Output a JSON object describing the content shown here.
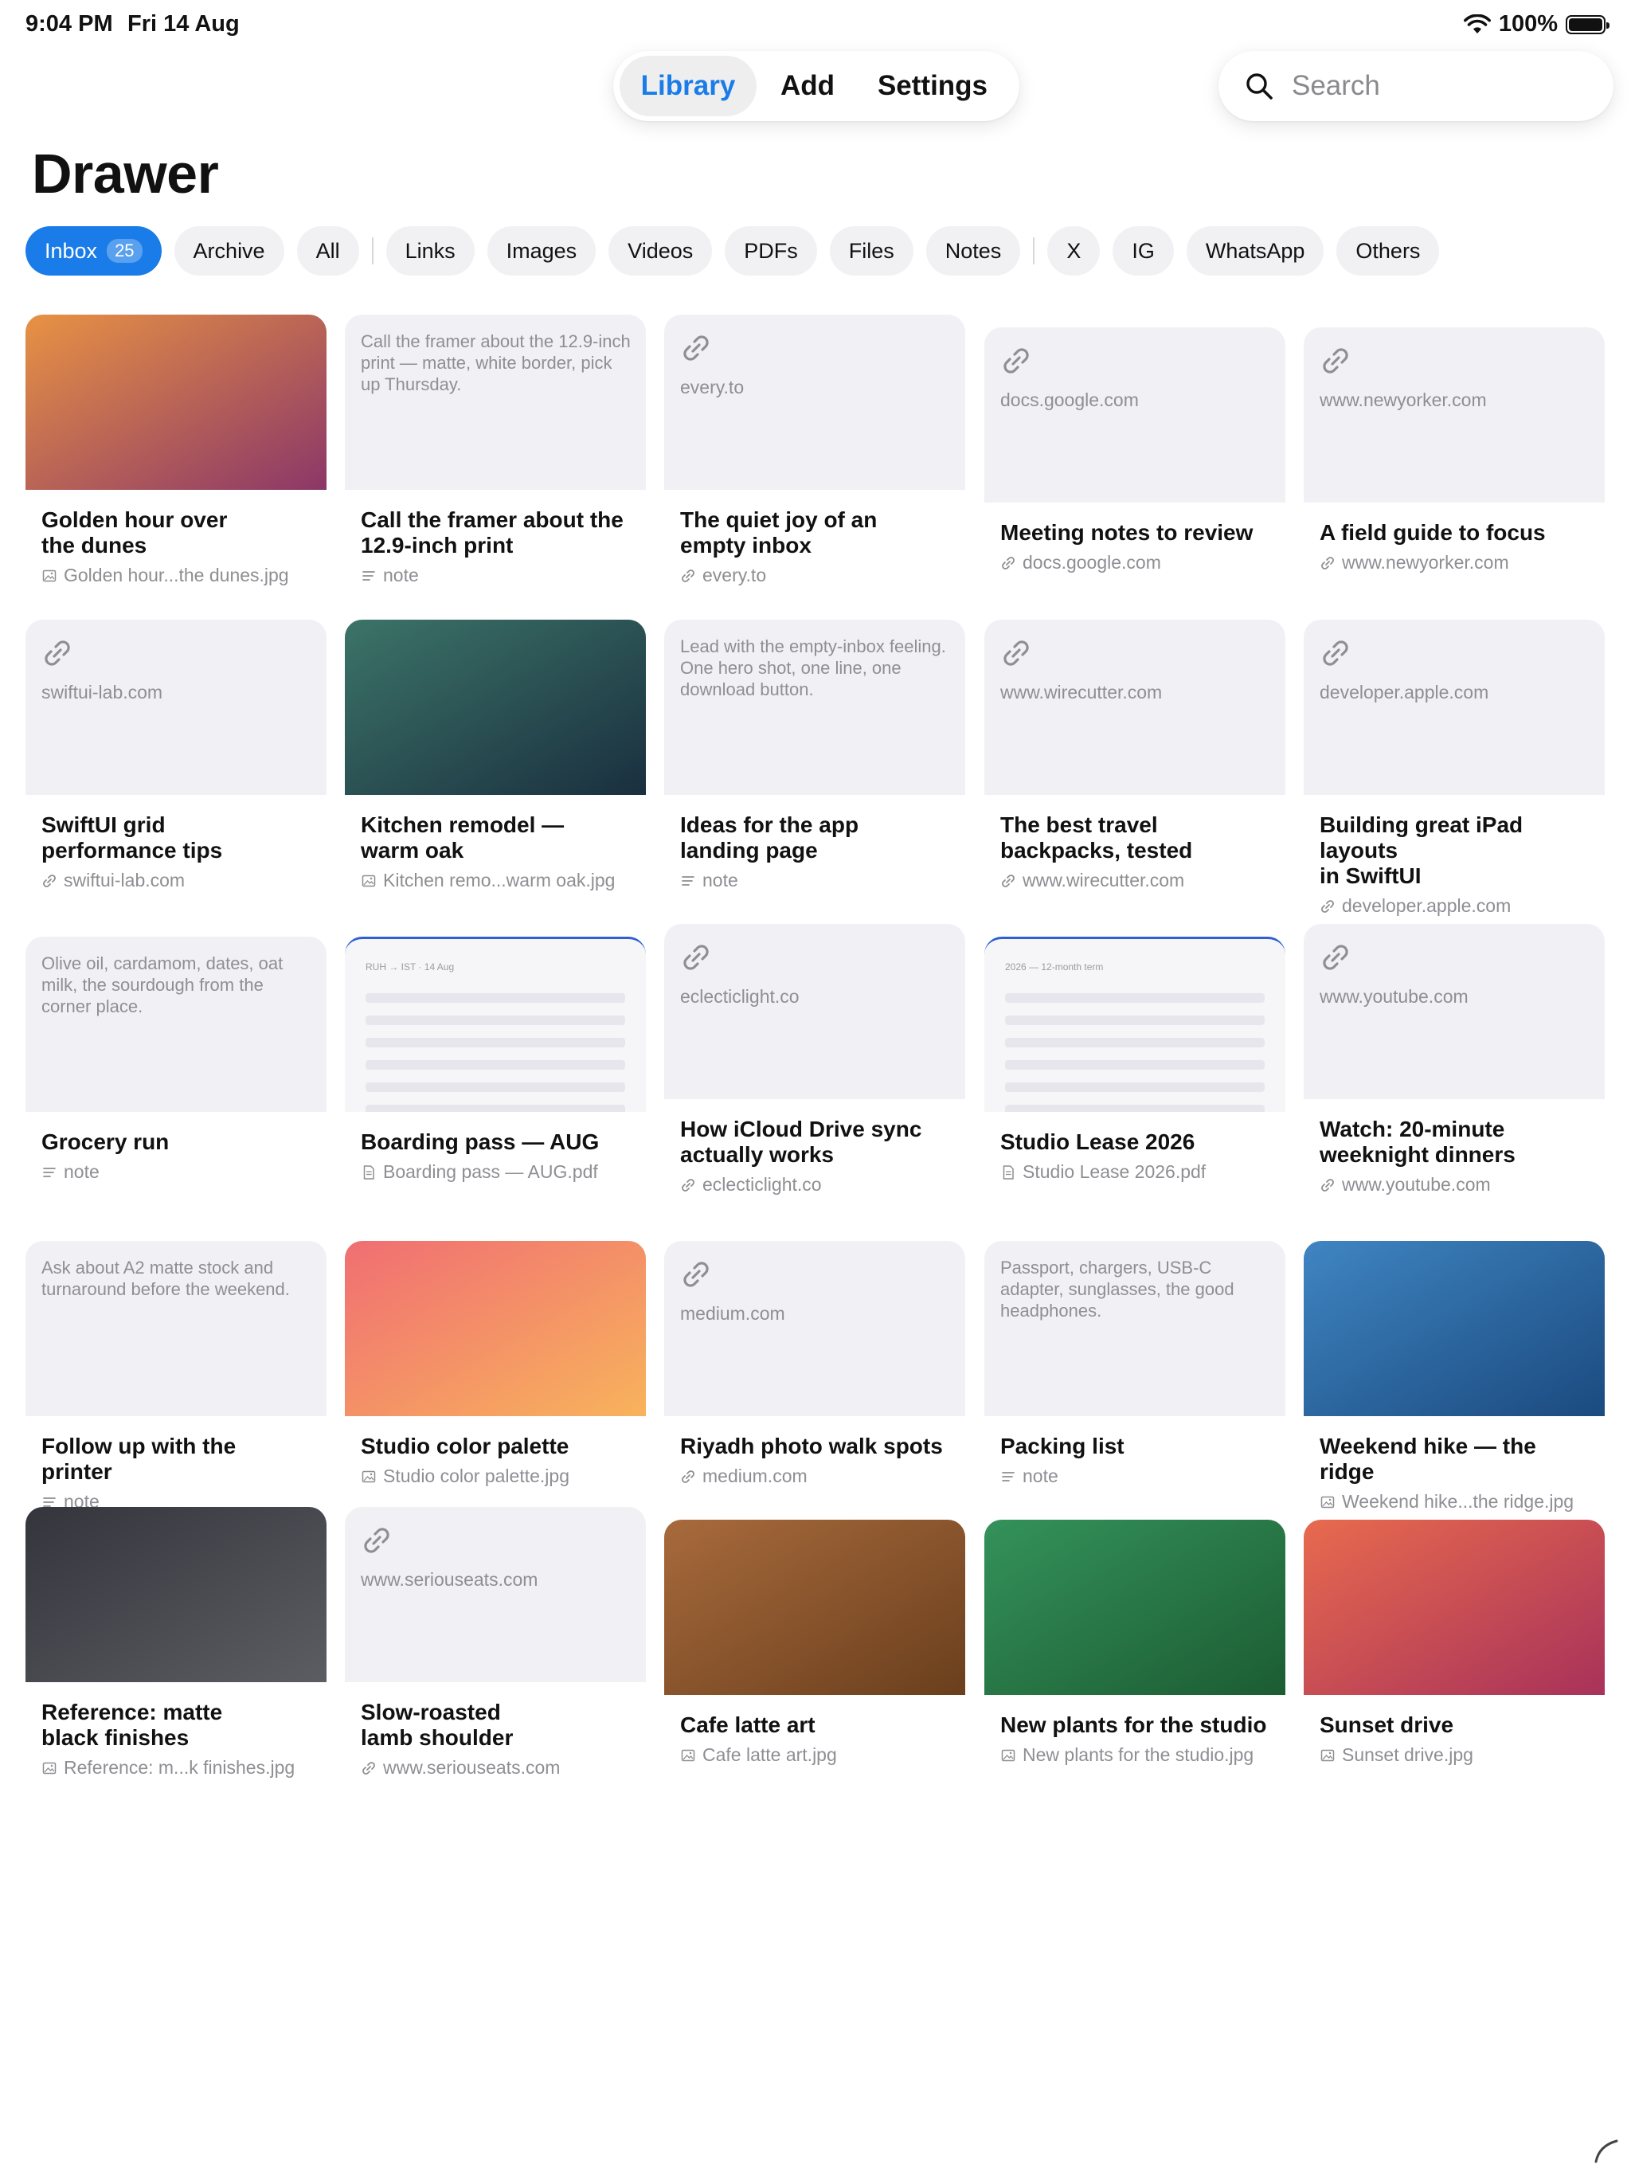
{
  "status_bar": {
    "time": "9:04 PM",
    "date": "Fri 14 Aug",
    "battery": "100%"
  },
  "nav": {
    "tabs": [
      "Library",
      "Add",
      "Settings"
    ],
    "active_tab": "Library"
  },
  "search": {
    "placeholder": "Search"
  },
  "page_title": "Drawer",
  "filters": [
    {
      "label": "Inbox",
      "count": "25",
      "active": true
    },
    {
      "label": "Archive"
    },
    {
      "label": "All"
    },
    {
      "separator": true
    },
    {
      "label": "Links"
    },
    {
      "label": "Images"
    },
    {
      "label": "Videos"
    },
    {
      "label": "PDFs"
    },
    {
      "label": "Files"
    },
    {
      "label": "Notes"
    },
    {
      "separator": true
    },
    {
      "label": "X"
    },
    {
      "label": "IG"
    },
    {
      "label": "WhatsApp"
    },
    {
      "label": "Others"
    }
  ],
  "items": [
    {
      "kind": "image",
      "title": "Golden hour over\nthe dunes",
      "meta": "Golden hour...the dunes.jpg",
      "gradient": [
        "#e89244",
        "#8b3768"
      ]
    },
    {
      "kind": "note",
      "title": "Call the framer about the\n12.9-inch print",
      "meta": "note",
      "preview": "Call the framer about the 12.9-inch print — matte, white border, pick up Thursday."
    },
    {
      "kind": "link",
      "title": "The quiet joy of an\nempty inbox",
      "meta": "every.to",
      "domain": "every.to"
    },
    {
      "kind": "link",
      "title": "Meeting notes to review",
      "meta": "docs.google.com",
      "domain": "docs.google.com"
    },
    {
      "kind": "link",
      "title": "A field guide to focus",
      "meta": "www.newyorker.com",
      "domain": "www.newyorker.com"
    },
    {
      "kind": "link",
      "title": "SwiftUI grid\nperformance tips",
      "meta": "swiftui-lab.com",
      "domain": "swiftui-lab.com"
    },
    {
      "kind": "image",
      "title": "Kitchen remodel —\nwarm oak",
      "meta": "Kitchen remo...warm oak.jpg",
      "gradient": [
        "#3c7468",
        "#1a2f3f"
      ]
    },
    {
      "kind": "note",
      "title": "Ideas for the app\nlanding page",
      "meta": "note",
      "preview": "Lead with the empty-inbox feeling. One hero shot, one line, one download button."
    },
    {
      "kind": "link",
      "title": "The best travel\nbackpacks, tested",
      "meta": "www.wirecutter.com",
      "domain": "www.wirecutter.com"
    },
    {
      "kind": "link",
      "title": "Building great iPad layouts\nin SwiftUI",
      "meta": "developer.apple.com",
      "domain": "developer.apple.com"
    },
    {
      "kind": "note",
      "title": "Grocery run",
      "meta": "note",
      "preview": "Olive oil, cardamom, dates, oat milk, the sourdough from the corner place."
    },
    {
      "kind": "pdf",
      "title": "Boarding pass — AUG",
      "meta": "Boarding pass — AUG.pdf",
      "doc_heading": "RUH → IST · 14 Aug"
    },
    {
      "kind": "link",
      "title": "How iCloud Drive sync\nactually works",
      "meta": "eclecticlight.co",
      "domain": "eclecticlight.co"
    },
    {
      "kind": "pdf",
      "title": "Studio Lease 2026",
      "meta": "Studio Lease 2026.pdf",
      "doc_heading": "2026 — 12-month term"
    },
    {
      "kind": "link",
      "title": "Watch: 20-minute\nweeknight dinners",
      "meta": "www.youtube.com",
      "domain": "www.youtube.com"
    },
    {
      "kind": "note",
      "title": "Follow up with the printer",
      "meta": "note",
      "preview": "Ask about A2 matte stock and turnaround before the weekend."
    },
    {
      "kind": "image",
      "title": "Studio color palette",
      "meta": "Studio color palette.jpg",
      "gradient": [
        "#f06e73",
        "#f8b35c"
      ]
    },
    {
      "kind": "link",
      "title": "Riyadh photo walk spots",
      "meta": "medium.com",
      "domain": "medium.com"
    },
    {
      "kind": "note",
      "title": "Packing list",
      "meta": "note",
      "preview": "Passport, chargers, USB-C adapter, sunglasses, the good headphones."
    },
    {
      "kind": "image",
      "title": "Weekend hike — the ridge",
      "meta": "Weekend hike...the ridge.jpg",
      "gradient": [
        "#3f85c2",
        "#1b4a7f"
      ]
    },
    {
      "kind": "image",
      "title": "Reference: matte\nblack finishes",
      "meta": "Reference: m...k finishes.jpg",
      "gradient": [
        "#34353c",
        "#5c5d63"
      ]
    },
    {
      "kind": "link",
      "title": "Slow-roasted\nlamb shoulder",
      "meta": "www.seriouseats.com",
      "domain": "www.seriouseats.com"
    },
    {
      "kind": "image",
      "title": "Cafe latte art",
      "meta": "Cafe latte art.jpg",
      "gradient": [
        "#a86a3c",
        "#6a3f1d"
      ]
    },
    {
      "kind": "image",
      "title": "New plants for the studio",
      "meta": "New plants for the studio.jpg",
      "gradient": [
        "#34925a",
        "#1c5c33"
      ]
    },
    {
      "kind": "image",
      "title": "Sunset drive",
      "meta": "Sunset drive.jpg",
      "gradient": [
        "#e86a4e",
        "#a8325a"
      ]
    }
  ],
  "colors": {
    "accent": "#1a7ce8",
    "card_bg": "#f1f1f5",
    "secondary_text": "#8e8e93"
  }
}
